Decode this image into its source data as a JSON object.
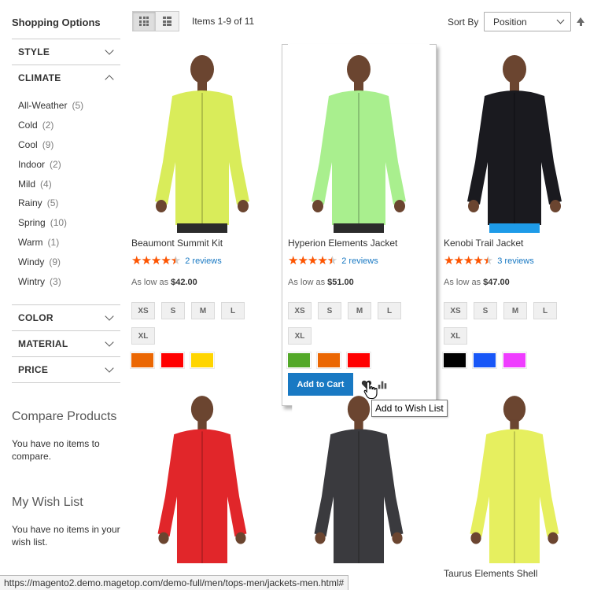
{
  "sidebar": {
    "title": "Shopping Options",
    "filters": {
      "style": "STYLE",
      "climate": "CLIMATE",
      "color": "COLOR",
      "material": "MATERIAL",
      "price": "PRICE"
    },
    "climate_options": [
      {
        "label": "All-Weather",
        "count": "5"
      },
      {
        "label": "Cold",
        "count": "2"
      },
      {
        "label": "Cool",
        "count": "9"
      },
      {
        "label": "Indoor",
        "count": "2"
      },
      {
        "label": "Mild",
        "count": "4"
      },
      {
        "label": "Rainy",
        "count": "5"
      },
      {
        "label": "Spring",
        "count": "10"
      },
      {
        "label": "Warm",
        "count": "1"
      },
      {
        "label": "Windy",
        "count": "9"
      },
      {
        "label": "Wintry",
        "count": "3"
      }
    ],
    "compare": {
      "title": "Compare Products",
      "text": "You have no items to compare."
    },
    "wishlist": {
      "title": "My Wish List",
      "text": "You have no items in your wish list."
    }
  },
  "toolbar": {
    "amount": "Items 1-9 of 11",
    "sort_label": "Sort By",
    "sort_value": "Position"
  },
  "products": [
    {
      "name": "Beaumont Summit Kit",
      "reviews": "2 reviews",
      "rating_percent": 90,
      "price_label": "As low as",
      "price": "$42.00",
      "sizes": [
        "XS",
        "S",
        "M",
        "L",
        "XL"
      ],
      "colors": [
        "#eb6703",
        "#ff0000",
        "#ffd500"
      ],
      "jacket_color": "#d9ec5a"
    },
    {
      "name": "Hyperion Elements Jacket",
      "reviews": "2 reviews",
      "rating_percent": 90,
      "price_label": "As low as",
      "price": "$51.00",
      "sizes": [
        "XS",
        "S",
        "M",
        "L",
        "XL"
      ],
      "colors": [
        "#53a828",
        "#eb6703",
        "#ff0000"
      ],
      "jacket_color": "#a9ef8e"
    },
    {
      "name": "Kenobi Trail Jacket",
      "reviews": "3 reviews",
      "rating_percent": 90,
      "price_label": "As low as",
      "price": "$47.00",
      "sizes": [
        "XS",
        "S",
        "M",
        "L",
        "XL"
      ],
      "colors": [
        "#000000",
        "#1857f7",
        "#ef3dff"
      ],
      "jacket_color": "#1a1a1f"
    },
    {
      "name": "",
      "jacket_color": "#e1262a"
    },
    {
      "name": "",
      "jacket_color": "#3a3a3e"
    },
    {
      "name": "Taurus Elements Shell",
      "jacket_color": "#e6ef5f"
    }
  ],
  "hover_actions": {
    "add_to_cart": "Add to Cart",
    "wishlist_tooltip": "Add to Wish List"
  },
  "status_bar": "https://magento2.demo.magetop.com/demo-full/men/tops-men/jackets-men.html#"
}
